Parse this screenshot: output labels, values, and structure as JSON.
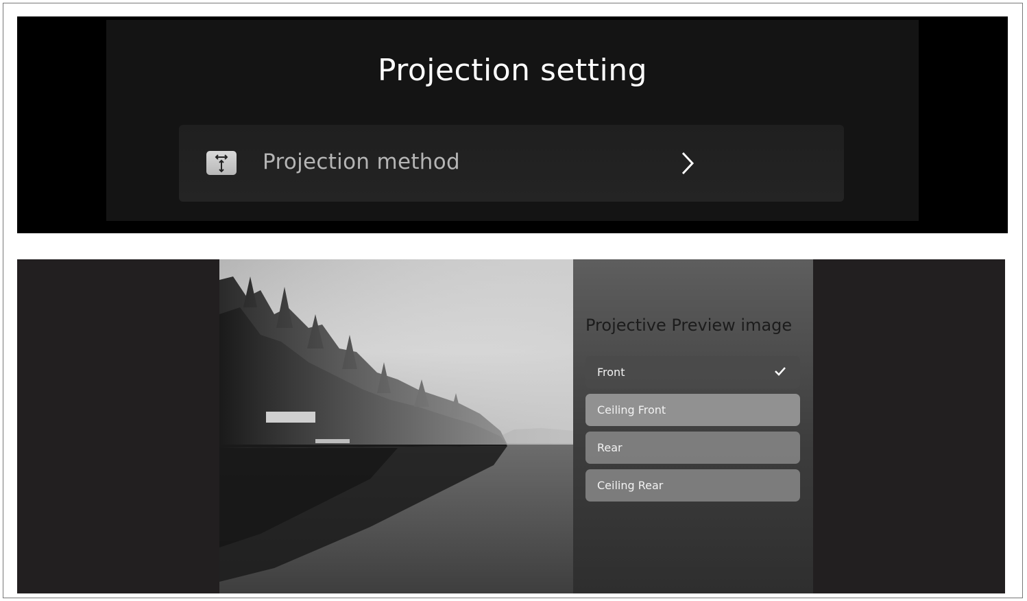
{
  "projection_setting": {
    "title": "Projection setting",
    "menu_item": {
      "label": "Projection method",
      "icon": "projection-method-icon",
      "arrow": "chevron-right-icon"
    }
  },
  "preview": {
    "image": "lake-forest-preview",
    "panel_title": "Projective Preview image",
    "options": [
      {
        "label": "Front",
        "selected": true
      },
      {
        "label": "Ceiling Front",
        "selected": false
      },
      {
        "label": "Rear",
        "selected": false
      },
      {
        "label": "Ceiling Rear",
        "selected": false
      }
    ],
    "selected_icon": "checkmark-icon"
  },
  "colors": {
    "top_background": "#000000",
    "settings_panel": "#141414",
    "bottom_background": "#221f20"
  }
}
